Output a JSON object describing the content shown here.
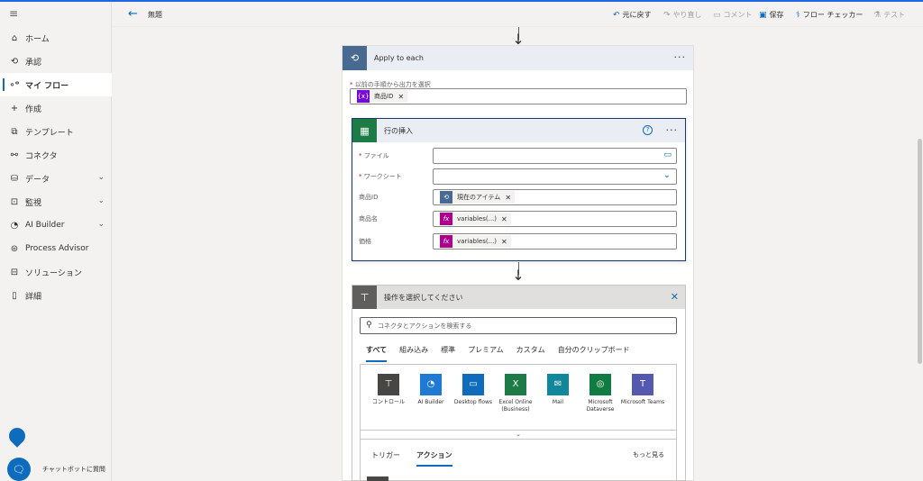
{
  "sidebar": {
    "items": [
      {
        "label": "ホーム",
        "icon": "home-icon",
        "glyph": "⌂",
        "chevron": false,
        "active": false
      },
      {
        "label": "承認",
        "icon": "approvals-icon",
        "glyph": "⟲",
        "chevron": false,
        "active": false
      },
      {
        "label": "マイ フロー",
        "icon": "flow-icon",
        "glyph": "∘ᵒ",
        "chevron": false,
        "active": true
      },
      {
        "label": "作成",
        "icon": "plus-icon",
        "glyph": "+",
        "chevron": false,
        "active": false
      },
      {
        "label": "テンプレート",
        "icon": "template-icon",
        "glyph": "⧉",
        "chevron": false,
        "active": false
      },
      {
        "label": "コネクタ",
        "icon": "connector-icon",
        "glyph": "⚯",
        "chevron": false,
        "active": false
      },
      {
        "label": "データ",
        "icon": "database-icon",
        "glyph": "⛁",
        "chevron": true,
        "active": false
      },
      {
        "label": "監視",
        "icon": "monitor-icon",
        "glyph": "⊡",
        "chevron": true,
        "active": false
      },
      {
        "label": "AI Builder",
        "icon": "ai-builder-icon",
        "glyph": "◔",
        "chevron": true,
        "active": false
      },
      {
        "label": "Process Advisor",
        "icon": "process-advisor-icon",
        "glyph": "⊜",
        "chevron": false,
        "active": false
      },
      {
        "label": "ソリューション",
        "icon": "solution-icon",
        "glyph": "⊟",
        "chevron": false,
        "active": false
      },
      {
        "label": "詳細",
        "icon": "book-icon",
        "glyph": "▯",
        "chevron": false,
        "active": false
      }
    ],
    "chatbot_label": "チャットボットに質問"
  },
  "header": {
    "title": "無題",
    "undo": "元に戻す",
    "redo": "やり直し",
    "comment": "コメント",
    "save": "保存",
    "flow_checker": "フロー チェッカー",
    "test": "テスト"
  },
  "apply_each": {
    "title": "Apply to each",
    "select_label": "以前の手順から出力を選択",
    "token_label": "商品ID",
    "token_icon_text": "{x}"
  },
  "insert_row": {
    "title": "行の挿入",
    "file_label": "ファイル",
    "worksheet_label": "ワークシート",
    "product_id_label": "商品ID",
    "product_name_label": "商品名",
    "price_label": "価格",
    "product_id_token": "現在のアイテム",
    "product_name_token": "variables(...)",
    "price_token": "variables(...)",
    "fx": "fx"
  },
  "choose_action": {
    "title": "操作を選択してください",
    "search_placeholder": "コネクタとアクションを検索する",
    "tabs": [
      "すべて",
      "組み込み",
      "標準",
      "プレミアム",
      "カスタム",
      "自分のクリップボード"
    ],
    "connectors": [
      {
        "name": "コントロール",
        "color": "#484644",
        "glyph": "⊤",
        "icon": "control-icon"
      },
      {
        "name": "AI Builder",
        "color": "#1f7ad4",
        "glyph": "◔",
        "icon": "ai-builder-connector-icon"
      },
      {
        "name": "Desktop flows",
        "color": "#0f6cbd",
        "glyph": "▭",
        "icon": "desktop-flows-icon"
      },
      {
        "name": "Excel Online (Business)",
        "color": "#1d7b45",
        "glyph": "X",
        "icon": "excel-icon"
      },
      {
        "name": "Mail",
        "color": "#10879a",
        "glyph": "✉",
        "icon": "mail-icon"
      },
      {
        "name": "Microsoft Dataverse",
        "color": "#107c41",
        "glyph": "◎",
        "icon": "dataverse-icon"
      },
      {
        "name": "Microsoft Teams",
        "color": "#5558af",
        "glyph": "T",
        "icon": "teams-icon"
      }
    ],
    "subtabs": {
      "trigger": "トリガー",
      "action": "アクション",
      "see_more": "もっと見る"
    }
  },
  "colors": {
    "accent": "#0f6cbd",
    "loop_header": "#486991",
    "excel": "#1d7b45",
    "variable": "#770bd6",
    "fx": "#ad008c"
  }
}
